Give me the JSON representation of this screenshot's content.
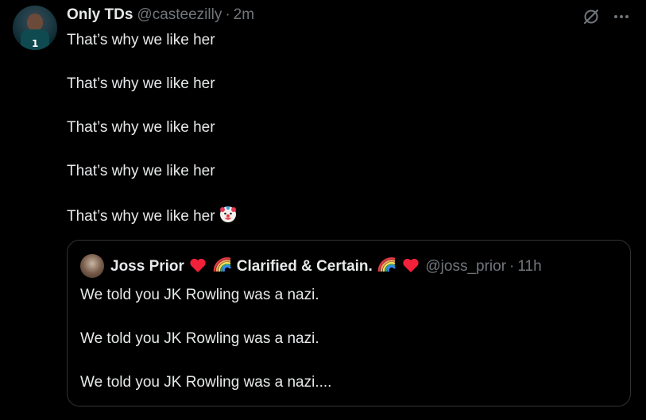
{
  "tweet": {
    "author_name": "Only TDs",
    "author_handle": "@casteezilly",
    "separator": "·",
    "time": "2m",
    "avatar_number": "1",
    "lines": [
      "That’s why we like her",
      "That’s why we like her",
      "That’s why we like her",
      "That’s why we like her",
      "That’s why we like her"
    ],
    "last_line_emoji": "clown-face-emoji"
  },
  "top_icons": {
    "left": "grok-slash-icon",
    "right": "more-options-icon"
  },
  "quote": {
    "author_name_part1": "Joss Prior",
    "author_name_part2": "Clarified & Certain.",
    "author_handle": "@joss_prior",
    "separator": "·",
    "time": "11h",
    "name_emojis": [
      "red-heart-emoji",
      "rainbow-emoji",
      "rainbow-emoji",
      "red-heart-emoji"
    ],
    "lines": [
      "We told you JK Rowling was a nazi.",
      "We told you JK Rowling was a nazi.",
      "We told you JK Rowling was a nazi...."
    ]
  },
  "colors": {
    "background": "#000000",
    "text": "#e7e9ea",
    "secondary_text": "#71767b",
    "border": "#2f3336",
    "heart": "#f2213a"
  }
}
